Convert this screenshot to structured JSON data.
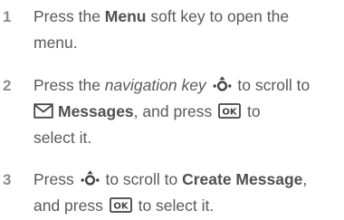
{
  "steps": [
    {
      "number": "1",
      "line1_pre": "Press the ",
      "menu_key": "Menu",
      "line1_post": " soft key to open the",
      "line2": "menu."
    },
    {
      "number": "2",
      "line1_pre": "Press the ",
      "nav_key_label": "navigation key",
      "line1_post": " to scroll to",
      "messages_label": "Messages",
      "line2_post": ", and press ",
      "line2_end": " to",
      "line3": "select it."
    },
    {
      "number": "3",
      "line1_pre": "Press ",
      "line1_mid": " to scroll to ",
      "create_label": "Create Message",
      "line1_end": ",",
      "line2_pre": "and press ",
      "line2_post": " to select it."
    }
  ],
  "icons": {
    "ok_key_text": "OK",
    "nav_key_icon": "navigation-key-icon",
    "ok_key_icon": "ok-key-icon",
    "messages_icon": "envelope-icon"
  }
}
